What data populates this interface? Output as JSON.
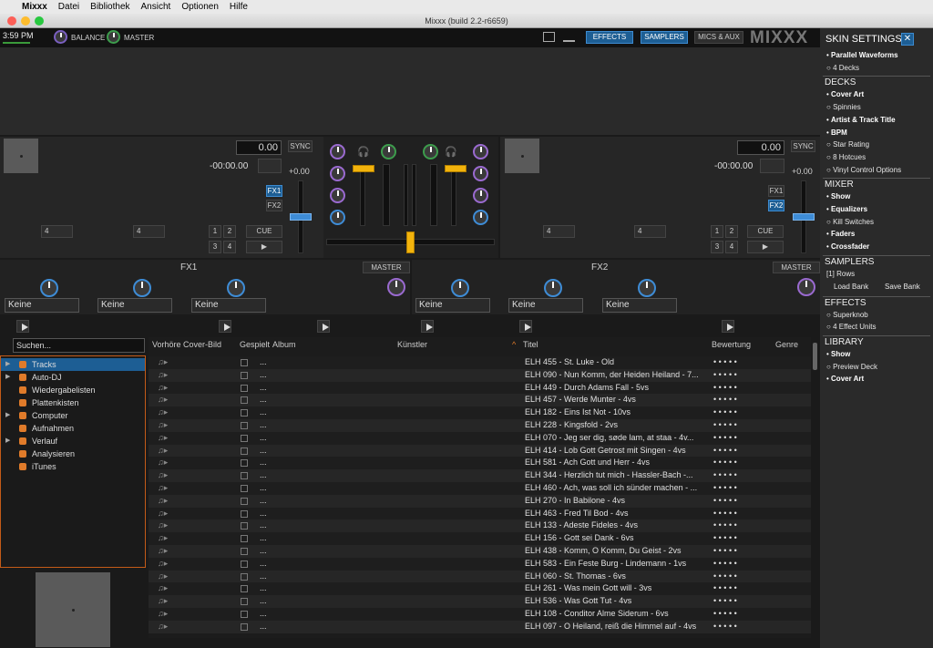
{
  "menubar": {
    "apple": "",
    "app": "Mixxx",
    "items": [
      "Datei",
      "Bibliothek",
      "Ansicht",
      "Optionen",
      "Hilfe"
    ]
  },
  "window": {
    "title": "Mixxx (build 2.2-r6659)"
  },
  "topbar": {
    "clock": "3:59 PM",
    "balance": "BALANCE",
    "master": "MASTER",
    "effects": "EFFECTS",
    "samplers": "SAMPLERS",
    "mics": "MICS & AUX",
    "logo": "MIXXX"
  },
  "deck1": {
    "bpm": "0.00",
    "time": "-00:00.00",
    "sync": "SYNC",
    "pitch": "+0.00",
    "fx1": "FX1",
    "fx2": "FX2",
    "loop": "4",
    "beatjump": "4",
    "hot": [
      "1",
      "2",
      "3",
      "4"
    ],
    "cue": "CUE"
  },
  "deck2": {
    "bpm": "0.00",
    "time": "-00:00.00",
    "sync": "SYNC",
    "pitch": "+0.00",
    "fx1": "FX1",
    "fx2": "FX2",
    "loop": "4",
    "beatjump": "4",
    "hot": [
      "1",
      "2",
      "3",
      "4"
    ],
    "cue": "CUE"
  },
  "fx": {
    "unit1": "FX1",
    "unit2": "FX2",
    "master": "MASTER",
    "slot": "Keine"
  },
  "library": {
    "search_placeholder": "Suchen...",
    "tree": [
      {
        "label": "Tracks",
        "arrow": "▶",
        "active": true
      },
      {
        "label": "Auto-DJ",
        "arrow": "▶"
      },
      {
        "label": "Wiedergabelisten",
        "arrow": ""
      },
      {
        "label": "Plattenkisten",
        "arrow": ""
      },
      {
        "label": "Computer",
        "arrow": "▶"
      },
      {
        "label": "Aufnahmen",
        "arrow": ""
      },
      {
        "label": "Verlauf",
        "arrow": "▶"
      },
      {
        "label": "Analysieren",
        "arrow": ""
      },
      {
        "label": "iTunes",
        "arrow": ""
      }
    ],
    "columns": {
      "preview": "Vorhöre",
      "cover": "Cover-Bild",
      "played": "Gespielt",
      "album": "Album",
      "artist": "Künstler",
      "title": "Titel",
      "rating": "Bewertung",
      "genre": "Genre"
    },
    "rows": [
      "ELH 455 - St. Luke - Old",
      "ELH 090 - Nun Komm, der Heiden Heiland - 7...",
      "ELH 449 - Durch Adams Fall - 5vs",
      "ELH 457 - Werde Munter - 4vs",
      "ELH 182 - Eins Ist Not - 10vs",
      "ELH 228 - Kingsfold - 2vs",
      "ELH 070 - Jeg ser dig, søde lam, at staa - 4v...",
      "ELH 414 - Lob Gott Getrost mit Singen - 4vs",
      "ELH 581 - Ach Gott und Herr - 4vs",
      "ELH 344 - Herzlich tut mich - Hassler-Bach -...",
      "ELH 460 - Ach, was soll ich sünder machen - ...",
      "ELH 270 - In Babilone - 4vs",
      "ELH 463 - Fred Til Bod - 4vs",
      "ELH 133 - Adeste Fideles - 4vs",
      "ELH 156 - Gott sei Dank - 6vs",
      "ELH 438 - Komm, O Komm, Du Geist - 2vs",
      "ELH 583 - Ein Feste Burg - Lindemann - 1vs",
      "ELH 060 - St. Thomas - 6vs",
      "ELH 261 - Was mein Gott will - 3vs",
      "ELH 536 - Was Gott Tut - 4vs",
      "ELH 108 - Conditor Alme Siderum - 6vs",
      "ELH 097 - O Heiland, reiß die Himmel auf - 4vs"
    ],
    "album_cell": "...",
    "rating_cell": "• • • • •"
  },
  "skin": {
    "title": "SKIN SETTINGS",
    "items": [
      {
        "type": "item",
        "label": "Parallel Waveforms",
        "on": true
      },
      {
        "type": "item",
        "label": "4 Decks",
        "on": false
      },
      {
        "type": "head",
        "label": "DECKS"
      },
      {
        "type": "item",
        "label": "Cover Art",
        "on": true
      },
      {
        "type": "item",
        "label": "Spinnies",
        "on": false
      },
      {
        "type": "item",
        "label": "Artist & Track Title",
        "on": true
      },
      {
        "type": "item",
        "label": "BPM",
        "on": true
      },
      {
        "type": "item",
        "label": "Star Rating",
        "on": false
      },
      {
        "type": "item",
        "label": "8 Hotcues",
        "on": false
      },
      {
        "type": "item",
        "label": "Vinyl Control Options",
        "on": false
      },
      {
        "type": "head",
        "label": "MIXER"
      },
      {
        "type": "item",
        "label": "Show",
        "on": true
      },
      {
        "type": "item",
        "label": "Equalizers",
        "on": true
      },
      {
        "type": "item",
        "label": "Kill Switches",
        "on": false
      },
      {
        "type": "item",
        "label": "Faders",
        "on": true
      },
      {
        "type": "item",
        "label": "Crossfader",
        "on": true
      },
      {
        "type": "head",
        "label": "SAMPLERS"
      },
      {
        "type": "plain",
        "label": "[1] Rows"
      },
      {
        "type": "pair",
        "label": "Load Bank",
        "label2": "Save Bank"
      },
      {
        "type": "head",
        "label": "EFFECTS"
      },
      {
        "type": "item",
        "label": "Superknob",
        "on": false
      },
      {
        "type": "item",
        "label": "4 Effect Units",
        "on": false
      },
      {
        "type": "head",
        "label": "LIBRARY"
      },
      {
        "type": "item",
        "label": "Show",
        "on": true
      },
      {
        "type": "item",
        "label": "Preview Deck",
        "on": false
      },
      {
        "type": "item",
        "label": "Cover Art",
        "on": true
      }
    ]
  }
}
